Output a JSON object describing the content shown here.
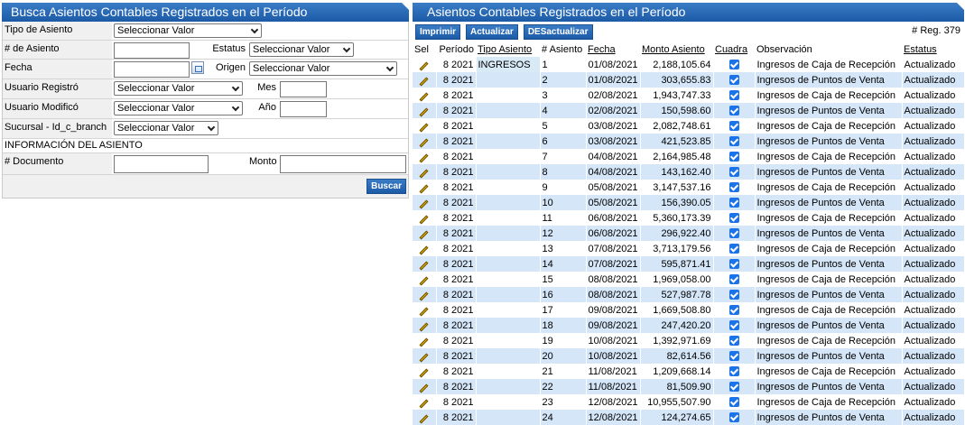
{
  "search_panel": {
    "title": "Busca Asientos Contables Registrados en el Período",
    "tipo_asiento_label": "Tipo de Asiento",
    "tipo_asiento_value": "Seleccionar Valor",
    "num_asiento_label": "# de Asiento",
    "num_asiento_value": "",
    "estatus_label": "Estatus",
    "estatus_value": "Seleccionar Valor",
    "fecha_label": "Fecha",
    "fecha_value": "",
    "origen_label": "Origen",
    "origen_value": "Seleccionar Valor",
    "usuario_registro_label": "Usuario Registró",
    "usuario_registro_value": "Seleccionar Valor",
    "mes_label": "Mes",
    "mes_value": "",
    "usuario_modifico_label": "Usuario Modificó",
    "usuario_modifico_value": "Seleccionar Valor",
    "anio_label": "Año",
    "anio_value": "",
    "sucursal_label": "Sucursal - Id_c_branch",
    "sucursal_value": "Seleccionar Valor",
    "info_header": "INFORMACIÓN DEL ASIENTO",
    "documento_label": "# Documento",
    "documento_value": "",
    "monto_label": "Monto",
    "monto_value": "",
    "buscar_label": "Buscar"
  },
  "results_panel": {
    "title": "Asientos Contables Registrados en el Período",
    "imprimir_label": "Imprimir",
    "actualizar_label": "Actualizar",
    "desactualizar_label": "DESactualizar",
    "reg_count": "# Reg. 379",
    "columns": [
      "Sel",
      "Período",
      "Tipo Asiento",
      "# Asiento",
      "Fecha",
      "Monto Asiento",
      "Cuadra",
      "Observación",
      "Estatus"
    ],
    "rows": [
      {
        "periodo": "8 2021",
        "tipo": "INGRESOS",
        "num": "1",
        "fecha": "01/08/2021",
        "monto": "2,188,105.64",
        "obs": "Ingresos de Caja de Recepción",
        "estatus": "Actualizado"
      },
      {
        "periodo": "8 2021",
        "tipo": "",
        "num": "2",
        "fecha": "01/08/2021",
        "monto": "303,655.83",
        "obs": "Ingresos de Puntos de Venta",
        "estatus": "Actualizado"
      },
      {
        "periodo": "8 2021",
        "tipo": "",
        "num": "3",
        "fecha": "02/08/2021",
        "monto": "1,943,747.33",
        "obs": "Ingresos de Caja de Recepción",
        "estatus": "Actualizado"
      },
      {
        "periodo": "8 2021",
        "tipo": "",
        "num": "4",
        "fecha": "02/08/2021",
        "monto": "150,598.60",
        "obs": "Ingresos de Puntos de Venta",
        "estatus": "Actualizado"
      },
      {
        "periodo": "8 2021",
        "tipo": "",
        "num": "5",
        "fecha": "03/08/2021",
        "monto": "2,082,748.61",
        "obs": "Ingresos de Caja de Recepción",
        "estatus": "Actualizado"
      },
      {
        "periodo": "8 2021",
        "tipo": "",
        "num": "6",
        "fecha": "03/08/2021",
        "monto": "421,523.85",
        "obs": "Ingresos de Puntos de Venta",
        "estatus": "Actualizado"
      },
      {
        "periodo": "8 2021",
        "tipo": "",
        "num": "7",
        "fecha": "04/08/2021",
        "monto": "2,164,985.48",
        "obs": "Ingresos de Caja de Recepción",
        "estatus": "Actualizado"
      },
      {
        "periodo": "8 2021",
        "tipo": "",
        "num": "8",
        "fecha": "04/08/2021",
        "monto": "143,162.40",
        "obs": "Ingresos de Puntos de Venta",
        "estatus": "Actualizado"
      },
      {
        "periodo": "8 2021",
        "tipo": "",
        "num": "9",
        "fecha": "05/08/2021",
        "monto": "3,147,537.16",
        "obs": "Ingresos de Caja de Recepción",
        "estatus": "Actualizado"
      },
      {
        "periodo": "8 2021",
        "tipo": "",
        "num": "10",
        "fecha": "05/08/2021",
        "monto": "156,390.05",
        "obs": "Ingresos de Puntos de Venta",
        "estatus": "Actualizado"
      },
      {
        "periodo": "8 2021",
        "tipo": "",
        "num": "11",
        "fecha": "06/08/2021",
        "monto": "5,360,173.39",
        "obs": "Ingresos de Caja de Recepción",
        "estatus": "Actualizado"
      },
      {
        "periodo": "8 2021",
        "tipo": "",
        "num": "12",
        "fecha": "06/08/2021",
        "monto": "296,922.40",
        "obs": "Ingresos de Puntos de Venta",
        "estatus": "Actualizado"
      },
      {
        "periodo": "8 2021",
        "tipo": "",
        "num": "13",
        "fecha": "07/08/2021",
        "monto": "3,713,179.56",
        "obs": "Ingresos de Caja de Recepción",
        "estatus": "Actualizado"
      },
      {
        "periodo": "8 2021",
        "tipo": "",
        "num": "14",
        "fecha": "07/08/2021",
        "monto": "595,871.41",
        "obs": "Ingresos de Puntos de Venta",
        "estatus": "Actualizado"
      },
      {
        "periodo": "8 2021",
        "tipo": "",
        "num": "15",
        "fecha": "08/08/2021",
        "monto": "1,969,058.00",
        "obs": "Ingresos de Caja de Recepción",
        "estatus": "Actualizado"
      },
      {
        "periodo": "8 2021",
        "tipo": "",
        "num": "16",
        "fecha": "08/08/2021",
        "monto": "527,987.78",
        "obs": "Ingresos de Puntos de Venta",
        "estatus": "Actualizado"
      },
      {
        "periodo": "8 2021",
        "tipo": "",
        "num": "17",
        "fecha": "09/08/2021",
        "monto": "1,669,508.80",
        "obs": "Ingresos de Caja de Recepción",
        "estatus": "Actualizado"
      },
      {
        "periodo": "8 2021",
        "tipo": "",
        "num": "18",
        "fecha": "09/08/2021",
        "monto": "247,420.20",
        "obs": "Ingresos de Puntos de Venta",
        "estatus": "Actualizado"
      },
      {
        "periodo": "8 2021",
        "tipo": "",
        "num": "19",
        "fecha": "10/08/2021",
        "monto": "1,392,971.69",
        "obs": "Ingresos de Caja de Recepción",
        "estatus": "Actualizado"
      },
      {
        "periodo": "8 2021",
        "tipo": "",
        "num": "20",
        "fecha": "10/08/2021",
        "monto": "82,614.56",
        "obs": "Ingresos de Puntos de Venta",
        "estatus": "Actualizado"
      },
      {
        "periodo": "8 2021",
        "tipo": "",
        "num": "21",
        "fecha": "11/08/2021",
        "monto": "1,209,668.14",
        "obs": "Ingresos de Caja de Recepción",
        "estatus": "Actualizado"
      },
      {
        "periodo": "8 2021",
        "tipo": "",
        "num": "22",
        "fecha": "11/08/2021",
        "monto": "81,509.90",
        "obs": "Ingresos de Puntos de Venta",
        "estatus": "Actualizado"
      },
      {
        "periodo": "8 2021",
        "tipo": "",
        "num": "23",
        "fecha": "12/08/2021",
        "monto": "10,955,507.90",
        "obs": "Ingresos de Caja de Recepción",
        "estatus": "Actualizado"
      },
      {
        "periodo": "8 2021",
        "tipo": "",
        "num": "24",
        "fecha": "12/08/2021",
        "monto": "124,274.65",
        "obs": "Ingresos de Puntos de Venta",
        "estatus": "Actualizado"
      }
    ]
  },
  "colors": {
    "header_blue": "#1c5aa6",
    "row_alt": "#d4e6f8",
    "check_blue": "#1a73e8"
  }
}
